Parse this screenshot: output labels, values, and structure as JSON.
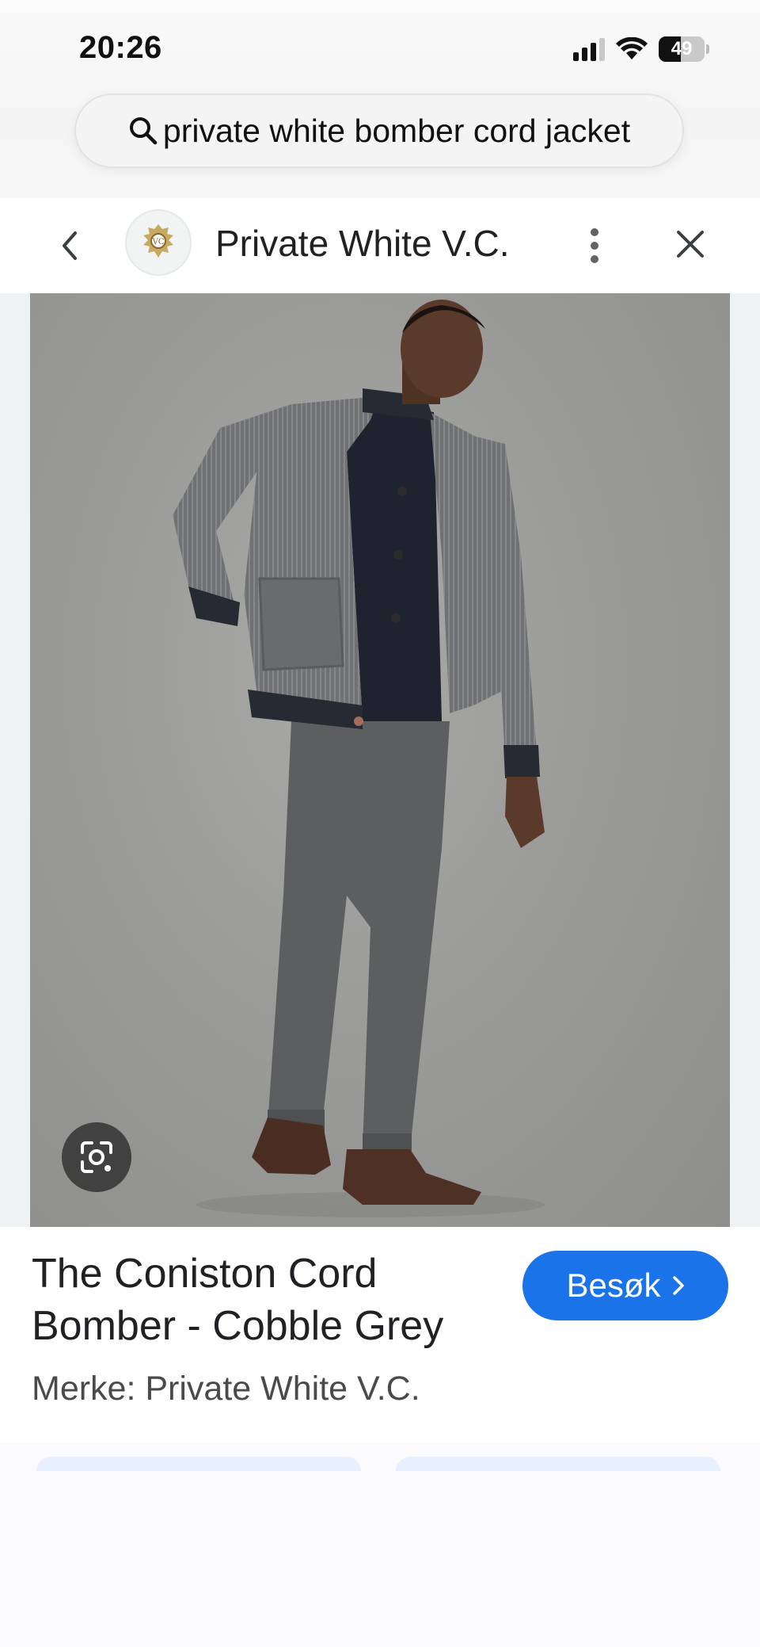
{
  "status_bar": {
    "time": "20:26",
    "battery_percent": "49",
    "battery_level": 0.49,
    "signal_bars": 3
  },
  "search": {
    "query": "private white bomber cord jacket",
    "icon": "search-icon"
  },
  "header": {
    "site_name": "Private White V.C.",
    "back_icon": "chevron-left-icon",
    "more_icon": "more-vert-icon",
    "close_icon": "close-icon",
    "logo": "site-logo"
  },
  "image": {
    "alt_subject": "Model in grey corduroy bomber jacket and grey trousers",
    "lens_icon": "google-lens-icon"
  },
  "product": {
    "title_line1": "The Coniston Cord",
    "title_line2": "Bomber - Cobble Grey",
    "brand": "Merke: Private White V.C.",
    "visit_label": "Besøk",
    "visit_icon": "chevron-right-icon"
  },
  "colors": {
    "accent": "#1a73e8",
    "jacket": "#6f7072",
    "trousers": "#5c5d5f",
    "shoes": "#4a2e22",
    "background": "#9b9b99"
  }
}
